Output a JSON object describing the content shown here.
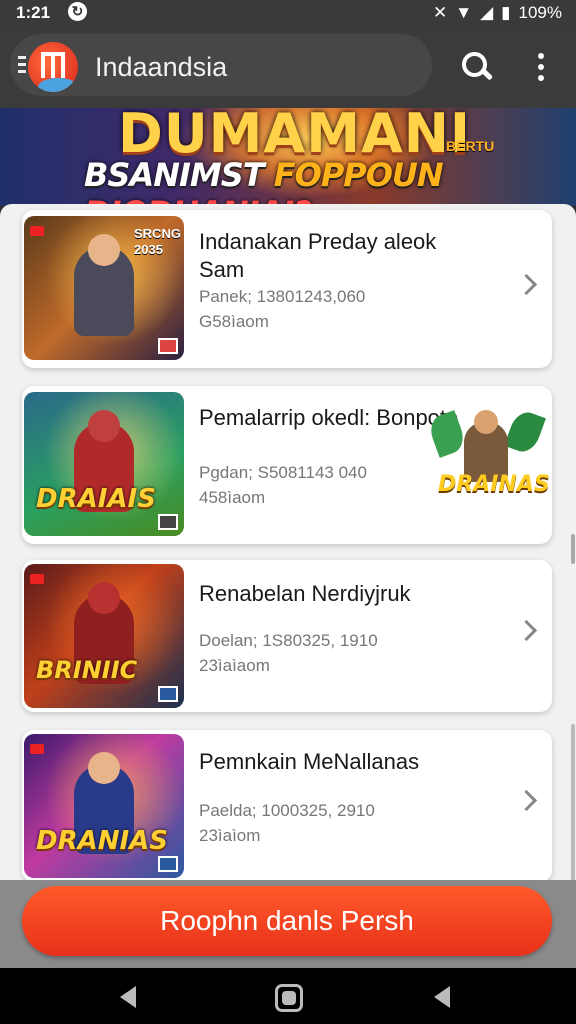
{
  "status_bar": {
    "time": "1:21",
    "battery": "109%"
  },
  "app_bar": {
    "title": "Indaandsia"
  },
  "banner": {
    "line1": "DUMAMANI",
    "line1_small": "BERTU",
    "line2_a": "BSANIMST",
    "line2_b": "FOPPOUN",
    "line2_c": "DIODHANIAI?"
  },
  "cards": [
    {
      "title": "Indanakan Preday aleok Sam",
      "meta1": "Panek; 13801243,060",
      "meta2": "G58ìaom",
      "thumb_word": "",
      "thumb_corner": "SRCNG 2035"
    },
    {
      "title": "Pemalarrip okedl: Bonpote",
      "meta1": "Pgdan; S5081143 040",
      "meta2": "458ìaom",
      "thumb_word": "DRAIAIS",
      "side_word": "DRAINAS"
    },
    {
      "title": "Renabelan Nerdiyjruk",
      "meta1": "Doelan; 1S80325, 1910",
      "meta2": "23ìaìaom",
      "thumb_word": "BRINIIC"
    },
    {
      "title": "Pemnkain MeNallanas",
      "meta1": "Paelda; 1000325, 2910",
      "meta2": "23ìaìom",
      "thumb_word": "DRANIAS"
    }
  ],
  "cta": {
    "label": "Roophn danls Persh"
  },
  "colors": {
    "accent": "#ee3a1f",
    "card_bg": "#ffffff",
    "list_bg": "#f1f1f1"
  }
}
